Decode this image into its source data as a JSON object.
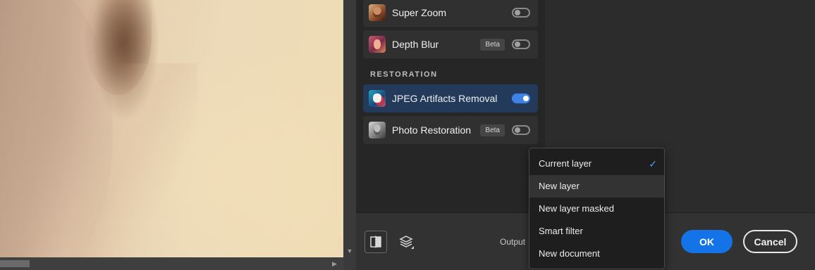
{
  "filters": {
    "items": [
      {
        "name": "Super Zoom",
        "beta": null,
        "enabled": false
      },
      {
        "name": "Depth Blur",
        "beta": "Beta",
        "enabled": false
      },
      {
        "name": "JPEG Artifacts Removal",
        "beta": null,
        "enabled": true
      },
      {
        "name": "Photo Restoration",
        "beta": "Beta",
        "enabled": false
      }
    ],
    "section_restoration": "RESTORATION"
  },
  "bottom_bar": {
    "output_label": "Output",
    "ok_label": "OK",
    "cancel_label": "Cancel"
  },
  "output_menu": {
    "options": [
      "Current layer",
      "New layer",
      "New layer masked",
      "Smart filter",
      "New document"
    ],
    "selected": "Current layer",
    "hovered": "New layer"
  },
  "colors": {
    "accent": "#1473e6",
    "toggle_on": "#3d83e6",
    "active_row": "#243a5a"
  },
  "icons": {
    "compare": "compare-view-icon",
    "layers": "layers-icon",
    "check": "checkmark-icon"
  }
}
